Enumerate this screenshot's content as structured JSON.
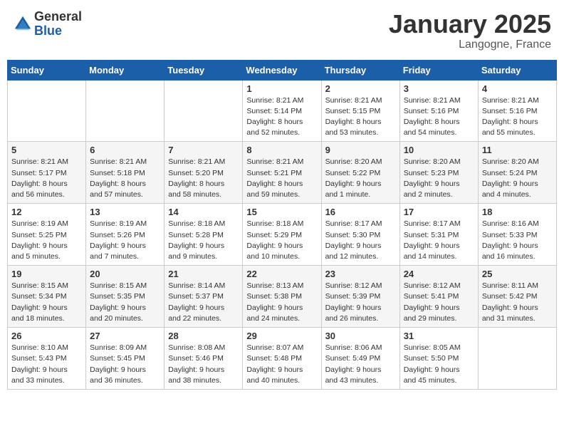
{
  "header": {
    "logo_general": "General",
    "logo_blue": "Blue",
    "month_title": "January 2025",
    "location": "Langogne, France"
  },
  "columns": [
    "Sunday",
    "Monday",
    "Tuesday",
    "Wednesday",
    "Thursday",
    "Friday",
    "Saturday"
  ],
  "weeks": [
    [
      {
        "day": "",
        "info": ""
      },
      {
        "day": "",
        "info": ""
      },
      {
        "day": "",
        "info": ""
      },
      {
        "day": "1",
        "info": "Sunrise: 8:21 AM\nSunset: 5:14 PM\nDaylight: 8 hours and 52 minutes."
      },
      {
        "day": "2",
        "info": "Sunrise: 8:21 AM\nSunset: 5:15 PM\nDaylight: 8 hours and 53 minutes."
      },
      {
        "day": "3",
        "info": "Sunrise: 8:21 AM\nSunset: 5:16 PM\nDaylight: 8 hours and 54 minutes."
      },
      {
        "day": "4",
        "info": "Sunrise: 8:21 AM\nSunset: 5:16 PM\nDaylight: 8 hours and 55 minutes."
      }
    ],
    [
      {
        "day": "5",
        "info": "Sunrise: 8:21 AM\nSunset: 5:17 PM\nDaylight: 8 hours and 56 minutes."
      },
      {
        "day": "6",
        "info": "Sunrise: 8:21 AM\nSunset: 5:18 PM\nDaylight: 8 hours and 57 minutes."
      },
      {
        "day": "7",
        "info": "Sunrise: 8:21 AM\nSunset: 5:20 PM\nDaylight: 8 hours and 58 minutes."
      },
      {
        "day": "8",
        "info": "Sunrise: 8:21 AM\nSunset: 5:21 PM\nDaylight: 8 hours and 59 minutes."
      },
      {
        "day": "9",
        "info": "Sunrise: 8:20 AM\nSunset: 5:22 PM\nDaylight: 9 hours and 1 minute."
      },
      {
        "day": "10",
        "info": "Sunrise: 8:20 AM\nSunset: 5:23 PM\nDaylight: 9 hours and 2 minutes."
      },
      {
        "day": "11",
        "info": "Sunrise: 8:20 AM\nSunset: 5:24 PM\nDaylight: 9 hours and 4 minutes."
      }
    ],
    [
      {
        "day": "12",
        "info": "Sunrise: 8:19 AM\nSunset: 5:25 PM\nDaylight: 9 hours and 5 minutes."
      },
      {
        "day": "13",
        "info": "Sunrise: 8:19 AM\nSunset: 5:26 PM\nDaylight: 9 hours and 7 minutes."
      },
      {
        "day": "14",
        "info": "Sunrise: 8:18 AM\nSunset: 5:28 PM\nDaylight: 9 hours and 9 minutes."
      },
      {
        "day": "15",
        "info": "Sunrise: 8:18 AM\nSunset: 5:29 PM\nDaylight: 9 hours and 10 minutes."
      },
      {
        "day": "16",
        "info": "Sunrise: 8:17 AM\nSunset: 5:30 PM\nDaylight: 9 hours and 12 minutes."
      },
      {
        "day": "17",
        "info": "Sunrise: 8:17 AM\nSunset: 5:31 PM\nDaylight: 9 hours and 14 minutes."
      },
      {
        "day": "18",
        "info": "Sunrise: 8:16 AM\nSunset: 5:33 PM\nDaylight: 9 hours and 16 minutes."
      }
    ],
    [
      {
        "day": "19",
        "info": "Sunrise: 8:15 AM\nSunset: 5:34 PM\nDaylight: 9 hours and 18 minutes."
      },
      {
        "day": "20",
        "info": "Sunrise: 8:15 AM\nSunset: 5:35 PM\nDaylight: 9 hours and 20 minutes."
      },
      {
        "day": "21",
        "info": "Sunrise: 8:14 AM\nSunset: 5:37 PM\nDaylight: 9 hours and 22 minutes."
      },
      {
        "day": "22",
        "info": "Sunrise: 8:13 AM\nSunset: 5:38 PM\nDaylight: 9 hours and 24 minutes."
      },
      {
        "day": "23",
        "info": "Sunrise: 8:12 AM\nSunset: 5:39 PM\nDaylight: 9 hours and 26 minutes."
      },
      {
        "day": "24",
        "info": "Sunrise: 8:12 AM\nSunset: 5:41 PM\nDaylight: 9 hours and 29 minutes."
      },
      {
        "day": "25",
        "info": "Sunrise: 8:11 AM\nSunset: 5:42 PM\nDaylight: 9 hours and 31 minutes."
      }
    ],
    [
      {
        "day": "26",
        "info": "Sunrise: 8:10 AM\nSunset: 5:43 PM\nDaylight: 9 hours and 33 minutes."
      },
      {
        "day": "27",
        "info": "Sunrise: 8:09 AM\nSunset: 5:45 PM\nDaylight: 9 hours and 36 minutes."
      },
      {
        "day": "28",
        "info": "Sunrise: 8:08 AM\nSunset: 5:46 PM\nDaylight: 9 hours and 38 minutes."
      },
      {
        "day": "29",
        "info": "Sunrise: 8:07 AM\nSunset: 5:48 PM\nDaylight: 9 hours and 40 minutes."
      },
      {
        "day": "30",
        "info": "Sunrise: 8:06 AM\nSunset: 5:49 PM\nDaylight: 9 hours and 43 minutes."
      },
      {
        "day": "31",
        "info": "Sunrise: 8:05 AM\nSunset: 5:50 PM\nDaylight: 9 hours and 45 minutes."
      },
      {
        "day": "",
        "info": ""
      }
    ]
  ]
}
